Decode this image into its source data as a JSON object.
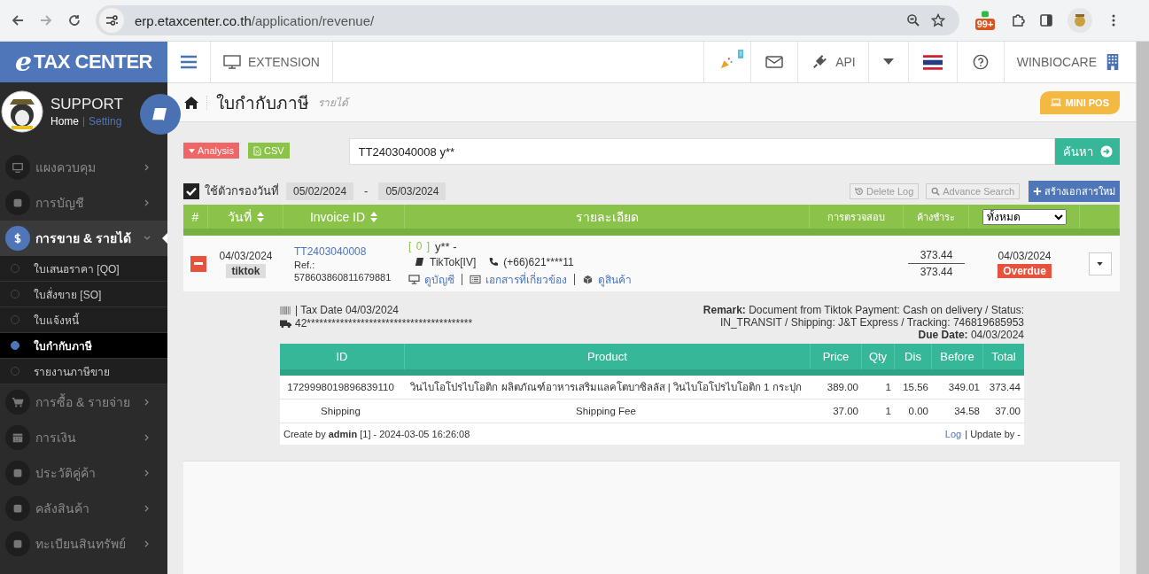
{
  "browser": {
    "host": "erp.etaxcenter.co.th",
    "path": "/application/revenue/",
    "badge": "99+"
  },
  "logo": {
    "mark": "e",
    "text": "TAX CENTER"
  },
  "user": {
    "name": "SUPPORT",
    "links": [
      {
        "label": "Home",
        "selected": true
      },
      {
        "label": "Setting",
        "selected": false
      }
    ]
  },
  "sidebar": {
    "items": [
      {
        "label": "แผงควบคุม",
        "selected": false,
        "expanded": false
      },
      {
        "label": "การบัญชี",
        "selected": false,
        "expanded": false
      },
      {
        "label": "การขาย & รายได้",
        "selected": true,
        "expanded": true,
        "children": [
          {
            "label": "ใบเสนอราคา [QO]",
            "selected": false
          },
          {
            "label": "ใบสั่งขาย [SO]",
            "selected": false
          },
          {
            "label": "ใบแจ้งหนี้",
            "selected": false
          },
          {
            "label": "ใบกำกับภาษี",
            "selected": true
          },
          {
            "label": "รายงานภาษีขาย",
            "selected": false
          }
        ]
      },
      {
        "label": "การซื้อ & รายจ่าย",
        "selected": false,
        "expanded": false
      },
      {
        "label": "การเงิน",
        "selected": false,
        "expanded": false
      },
      {
        "label": "ประวัติคู่ค้า",
        "selected": false,
        "expanded": false
      },
      {
        "label": "คลังสินค้า",
        "selected": false,
        "expanded": false
      },
      {
        "label": "ทะเบียนสินทรัพย์",
        "selected": false,
        "expanded": false
      }
    ]
  },
  "topnav": {
    "extension": "EXTENSION",
    "notification_badge": "!",
    "api": "API",
    "company": "WINBIOCARE"
  },
  "page": {
    "title": "ใบกำกับภาษี",
    "subtitle": "รายได้",
    "mini_pos": "MINI POS"
  },
  "toolbar": {
    "analysis": "Analysis",
    "csv": "CSV",
    "search_value": "TT2403040008 y**",
    "search_button": "ค้นหา"
  },
  "filter": {
    "checked": true,
    "label": "ใช้ตัวกรองวันที่",
    "from": "05/02/2024",
    "separator": "-",
    "to": "05/03/2024",
    "delete_log": "Delete Log",
    "advance_search": "Advance Search",
    "create": "สร้างเอกสารใหม่"
  },
  "table": {
    "columns": [
      {
        "label": "#",
        "sortable": false
      },
      {
        "label": "วันที่",
        "sortable": true
      },
      {
        "label": "Invoice ID",
        "sortable": true
      },
      {
        "label": "รายละเอียด",
        "sortable": false
      },
      {
        "label": "การตรวจสอบ",
        "sortable": false
      },
      {
        "label": "ค้างชำระ",
        "sortable": false
      }
    ],
    "status_filter": "ทั้งหมด",
    "rows": [
      {
        "expanded": true,
        "date": "04/03/2024",
        "channel": "tiktok",
        "invoice": "TT2403040008",
        "ref_label": "Ref.:",
        "ref": "578603860811679881",
        "code": "[ 0 ]",
        "customer": "y** -",
        "book": "TikTok[IV]",
        "phone": "(+66)621****11",
        "links": [
          "ดูบัญชี",
          "เอกสารที่เกี่ยวข้อง",
          "ดูสินค้า"
        ],
        "amount": "373.44",
        "outstanding": "373.44",
        "due": "04/03/2024",
        "status": "Overdue"
      }
    ]
  },
  "detail": {
    "tax_date": "| Tax Date 04/03/2024",
    "tracking": "42****************************************",
    "remark": "**Remark:** Document from Tiktok Payment: Cash on delivery / Status: IN_TRANSIT / Shipping: J&T Express / Tracking: 746819685953",
    "due": "**Due Date:** 04/03/2024",
    "columns": [
      "ID",
      "Product",
      "Price",
      "Qty",
      "Dis",
      "Before",
      "Total"
    ],
    "lines": [
      [
        "1729998019896839110",
        "วินไบโอโปรไบโอติก ผลิตภัณฑ์อาหารเสริมแลคโตบาซิลลัส | วินไบโอโปรไบโอติก 1 กระปุก",
        "389.00",
        "1",
        "15.56",
        "349.01",
        "373.44"
      ],
      [
        "Shipping",
        "Shipping Fee",
        "37.00",
        "1",
        "0.00",
        "34.58",
        "37.00"
      ]
    ],
    "created": "Create by **admin** [1] - 2024-03-05 16:26:08",
    "log_link": "Log",
    "updated": "| Update by -"
  }
}
